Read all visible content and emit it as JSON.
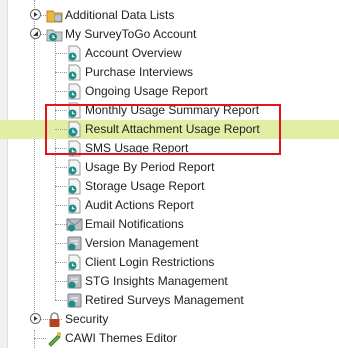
{
  "tree": {
    "items": [
      {
        "label": "Additional Data Lists",
        "icon": "folder-data-lists-icon",
        "toggle": "expand-toggle"
      },
      {
        "label": "My SurveyToGo Account",
        "icon": "account-folder-icon",
        "toggle": "collapse-toggle"
      },
      {
        "label": "Account Overview",
        "icon": "account-overview-icon"
      },
      {
        "label": "Purchase Interviews",
        "icon": "purchase-interviews-icon"
      },
      {
        "label": "Ongoing Usage Report",
        "icon": "ongoing-usage-report-icon"
      },
      {
        "label": "Monthly Usage Summary Report",
        "icon": "monthly-usage-report-icon"
      },
      {
        "label": "Result Attachment Usage Report",
        "icon": "attachment-usage-report-icon",
        "selected": true
      },
      {
        "label": "SMS Usage Report",
        "icon": "sms-usage-report-icon"
      },
      {
        "label": "Usage By Period Report",
        "icon": "usage-by-period-report-icon"
      },
      {
        "label": "Storage Usage Report",
        "icon": "storage-usage-report-icon"
      },
      {
        "label": "Audit Actions Report",
        "icon": "audit-actions-report-icon"
      },
      {
        "label": "Email Notifications",
        "icon": "email-notifications-icon"
      },
      {
        "label": "Version Management",
        "icon": "version-management-icon"
      },
      {
        "label": "Client Login Restrictions",
        "icon": "client-login-restrictions-icon"
      },
      {
        "label": "STG Insights Management",
        "icon": "insights-management-icon"
      },
      {
        "label": "Retired Surveys Management",
        "icon": "retired-surveys-icon"
      },
      {
        "label": "Security",
        "icon": "security-lock-icon",
        "toggle": "expand-toggle"
      },
      {
        "label": "CAWI Themes Editor",
        "icon": "cawi-themes-editor-icon"
      }
    ]
  },
  "colors": {
    "selected_row": "#e1eea3",
    "highlight_box": "#e2141c",
    "teal": "#1e8f86",
    "folder": "#e8b83a",
    "lock": "#b54322"
  }
}
